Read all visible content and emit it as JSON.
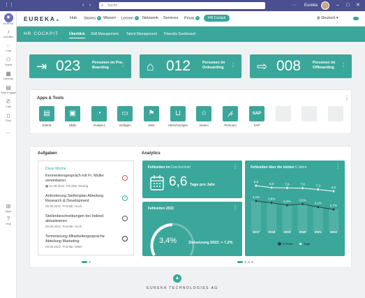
{
  "topbar": {
    "search_placeholder": "Suche",
    "user_name": "Eureka"
  },
  "sidebar": {
    "items": [
      {
        "label": "EUREKA",
        "icon": "home-icon"
      },
      {
        "label": "Activities",
        "icon": "bell-icon"
      },
      {
        "label": "Chat",
        "icon": "chat-icon"
      },
      {
        "label": "Teams",
        "icon": "teams-icon"
      },
      {
        "label": "Calendar",
        "icon": "calendar-icon"
      },
      {
        "label": "Wise Engage",
        "icon": "book-icon"
      },
      {
        "label": "Calls",
        "icon": "phone-icon"
      },
      {
        "label": "Files",
        "icon": "file-icon"
      },
      {
        "label": "...",
        "icon": "more-icon"
      }
    ],
    "bottom": [
      {
        "label": "Apps",
        "icon": "apps-icon"
      },
      {
        "label": "Help",
        "icon": "help-icon"
      }
    ]
  },
  "header": {
    "logo": "EUREKA",
    "nav": [
      {
        "label": "Hub",
        "badge": false
      },
      {
        "label": "Stories",
        "badge": true
      },
      {
        "label": "Wissen",
        "badge": false
      },
      {
        "label": "Lernen",
        "badge": true
      },
      {
        "label": "Netzwerk",
        "badge": false
      },
      {
        "label": "Services",
        "badge": false
      },
      {
        "label": "Privat",
        "badge": true
      }
    ],
    "active_pill": "HR Cockpit",
    "language": "Deutsch"
  },
  "banner": {
    "title": "HR COCKPIT",
    "tabs": [
      "Überblick",
      "Skill Management",
      "Talent Management",
      "Diversity Dashboard"
    ]
  },
  "kpis": [
    {
      "number": "023",
      "label": "Personen im Pre-Boarding",
      "icon": "login-arrow-icon"
    },
    {
      "number": "012",
      "label": "Personen im Onboarding",
      "icon": "house-icon"
    },
    {
      "number": "008",
      "label": "Personen im Offboarding",
      "icon": "logout-arrow-icon"
    }
  ],
  "apps": {
    "title": "Apps & Tools",
    "items": [
      {
        "label": "Eintritt",
        "icon": "document-icon"
      },
      {
        "label": "Skills",
        "icon": "briefcase-icon"
      },
      {
        "label": "Analytics",
        "icon": "pie-chart-icon"
      },
      {
        "label": "Vorlagen",
        "icon": "folder-icon"
      },
      {
        "label": "Ziele",
        "icon": "flag-icon"
      },
      {
        "label": "Abrechnungen",
        "icon": "inbox-icon"
      },
      {
        "label": "Alumni",
        "icon": "star-icon"
      },
      {
        "label": "Personio",
        "icon": "personio-icon"
      },
      {
        "label": "SAP",
        "icon": "sap-logo-icon"
      }
    ]
  },
  "tasks": {
    "title": "Aufgaben",
    "week_label": "Diese Woche",
    "items": [
      {
        "title": "Kennenlerngespräch mit Fr. Müller vereinbaren",
        "date": "01.09.2022",
        "priority": "Priorität: Niedrig",
        "status": "open-urgent"
      },
      {
        "title": "Anforderung Stellenplan Abteilung Research & Development",
        "date": "05.09.2022",
        "priority": "Priorität: Hoch",
        "status": "done"
      },
      {
        "title": "Stellenbeschreibungen bei Indeed aktualisieren",
        "date": "08.09.2022",
        "priority": "Priorität: Hoch",
        "status": "open"
      },
      {
        "title": "Terminierung Mitarbeitergespräche Abteilung Marketing",
        "date": "09.09.2022",
        "priority": "Priorität: Mittel",
        "status": "next"
      }
    ]
  },
  "analytics": {
    "title": "Analytics",
    "absence_avg": {
      "title": "Fehlzeiten im",
      "title_hl": "Durchschnitt",
      "value": "6,6",
      "unit": "Tage pro Jahr"
    },
    "absence_2022": {
      "title": "Fehlzeiten 2022",
      "value": "3,4%",
      "target": "Zielsetzung 2022: < 7,2%",
      "progress": 0.47
    },
    "absence_years": {
      "title": "Fehlzeiten über die letzten",
      "title_hl": "5 Jahre"
    }
  },
  "chart_data": {
    "type": "line",
    "title": "Fehlzeiten über die letzten 5 Jahre",
    "categories": [
      "2017",
      "2018",
      "2019",
      "2020",
      "2021",
      "2022"
    ],
    "series": [
      {
        "name": "% Rate",
        "values": [
          4.1,
          3.8,
          3.4,
          3.6,
          3.1,
          2.7
        ],
        "labels": [
          "4,1%",
          "3,8%",
          "3,4%",
          "3,6%",
          "3,1%",
          "2,7%"
        ]
      },
      {
        "name": "Tage",
        "values": [
          8.8,
          8.0,
          7.9,
          7.8,
          7.3,
          6.6
        ],
        "labels": [
          "8,8",
          "8,0",
          "7,9",
          "7,8",
          "7,3",
          "6,6"
        ]
      }
    ],
    "colors": {
      "rate": "#2e3f4d",
      "tage": "#ffffff"
    }
  },
  "footer": {
    "text": "EUREKA TECHNOLOGIES AG"
  },
  "colors": {
    "accent": "#3aa79a",
    "topbar": "#4a4f8f"
  }
}
